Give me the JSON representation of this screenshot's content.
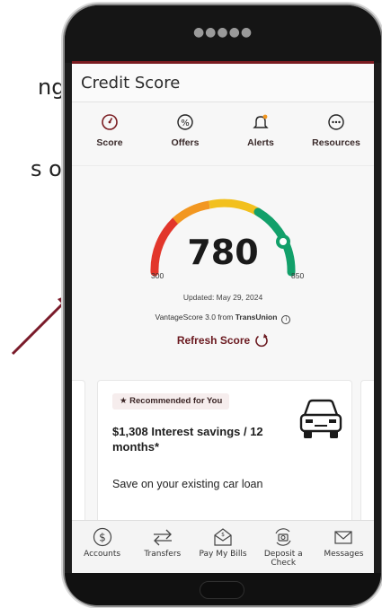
{
  "background": {
    "text_1": "ng",
    "text_2": "s of"
  },
  "page": {
    "title": "Credit Score"
  },
  "tabs": [
    {
      "label": "Score",
      "icon": "gauge-icon"
    },
    {
      "label": "Offers",
      "icon": "percent-icon"
    },
    {
      "label": "Alerts",
      "icon": "bell-icon"
    },
    {
      "label": "Resources",
      "icon": "ellipsis-icon"
    }
  ],
  "score": {
    "value": "780",
    "min": "300",
    "max": "850",
    "updated": "Updated: May 29, 2024",
    "source_prefix": "VantageScore 3.0 from ",
    "source_bureau": "TransUnion",
    "info_icon": "info-icon",
    "refresh_label": "Refresh Score"
  },
  "offer": {
    "badge": "Recommended for You",
    "headline": "$1,308 Interest savings / 12 months*",
    "description": "Save on your existing car loan",
    "icon": "car-icon"
  },
  "bottom_nav": [
    {
      "label": "Accounts",
      "icon": "dollar-icon"
    },
    {
      "label": "Transfers",
      "icon": "transfer-arrows-icon"
    },
    {
      "label": "Pay My Bills",
      "icon": "pay-bills-envelope-icon"
    },
    {
      "label": "Deposit a Check",
      "icon": "camera-deposit-icon"
    },
    {
      "label": "Messages",
      "icon": "envelope-icon"
    }
  ],
  "colors": {
    "brand": "#7a1b20",
    "gauge_red": "#e2362b",
    "gauge_orange": "#f29721",
    "gauge_yellow": "#f2c01e",
    "gauge_green": "#12a06a"
  }
}
